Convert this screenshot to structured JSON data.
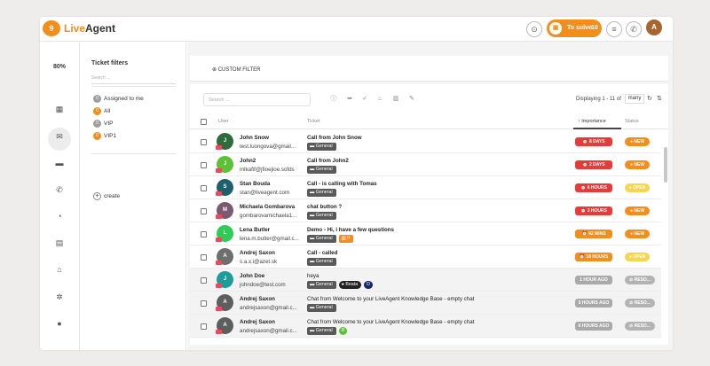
{
  "app": {
    "logo_badge": "9",
    "logo_live": "Live",
    "logo_agent": "Agent",
    "brand_color": "#f28e1c"
  },
  "topbar": {
    "to_solve_label": "To solve",
    "to_solve_count": "10",
    "user_initial": "A",
    "icons": [
      "settings-icon",
      "chat-icon",
      "phone-icon"
    ]
  },
  "nav": {
    "zoom": "80%",
    "items": [
      "dashboard-icon",
      "tickets-icon",
      "chats-icon",
      "calls-icon",
      "reports-icon",
      "contacts-icon",
      "knowledgebase-icon",
      "configuration-icon",
      "help-icon"
    ]
  },
  "filters": {
    "title": "Ticket filters",
    "search_placeholder": "Search ...",
    "items": [
      {
        "label": "Assigned to me",
        "badge": "0",
        "color": "#9e9e9e"
      },
      {
        "label": "All",
        "badge": "0",
        "color": "#f28e1c"
      },
      {
        "label": "VIP",
        "badge": "0",
        "color": "#9e9e9e"
      },
      {
        "label": "VIP1",
        "badge": "0",
        "color": "#f28e1c"
      }
    ],
    "create_label": "create"
  },
  "main": {
    "custom_filter": "CUSTOM FILTER",
    "search_placeholder": "Search ...",
    "displaying": "Displaying 1 - 11 of",
    "many": "many",
    "columns": {
      "user": "User",
      "ticket": "Ticket",
      "importance": "Importance",
      "status": "Status"
    }
  },
  "rows": [
    {
      "name": "John Snow",
      "email": "test.luongova@gmail...",
      "subject": "Call from John Snow",
      "tags": [
        "General"
      ],
      "importance": "8 DAYS",
      "status": "NEW",
      "initial": "J",
      "avatar_color": "#2f6b3c",
      "imp_color": "red",
      "status_type": "new"
    },
    {
      "name": "John2",
      "email": "mlkafif@jfioejioe.sofds",
      "subject": "Call from John2",
      "tags": [
        "General"
      ],
      "importance": "2 DAYS",
      "status": "NEW",
      "initial": "J",
      "avatar_color": "#5bc236",
      "imp_color": "red",
      "status_type": "new"
    },
    {
      "name": "Stan Bouda",
      "email": "stan@liveagent.com",
      "subject": "Call - is calling with Tomas",
      "tags": [
        "General"
      ],
      "importance": "6 HOURS",
      "status": "OPEN",
      "initial": "S",
      "avatar_color": "#1e5f6b",
      "imp_color": "red",
      "status_type": "open"
    },
    {
      "name": "Michaela Gombarova",
      "email": "gombarovamichaela1...",
      "subject": "chat button ?",
      "tags": [
        "General"
      ],
      "importance": "3 HOURS",
      "status": "NEW",
      "initial": "M",
      "avatar_color": "#7a5a6e",
      "imp_color": "red",
      "status_type": "new"
    },
    {
      "name": "Lena Butler",
      "email": "lena.m.butler@gmail.c...",
      "subject": "Demo - Hi, i have a few questions",
      "tags": [
        "General",
        "II"
      ],
      "importance": "42 MINS",
      "status": "NEW",
      "initial": "L",
      "avatar_color": "#2ecc55",
      "imp_color": "orange",
      "status_type": "new"
    },
    {
      "name": "Andrej Saxon",
      "email": "s.a.x.i@azet.sk",
      "subject": "Call - called",
      "tags": [
        "General"
      ],
      "importance": "18 HOURS",
      "status": "OPEN",
      "initial": "A",
      "avatar_color": "#6e6e6e",
      "imp_color": "orange",
      "status_type": "open"
    },
    {
      "name": "John Doe",
      "email": "johndoe@test.com",
      "subject": "heya",
      "tags": [
        "General",
        "Beata",
        "D"
      ],
      "importance": "1 HOUR AGO",
      "status": "RESO...",
      "initial": "J",
      "avatar_color": "#1f9c99",
      "imp_color": "grey",
      "status_type": "reso"
    },
    {
      "name": "Andrej Saxon",
      "email": "andrejsaxon@gmail.c...",
      "subject": "Chat from Welcome to your LiveAgent Knowledge Base - empty chat",
      "tags": [
        "General"
      ],
      "importance": "5 HOURS AGO",
      "status": "RESO...",
      "initial": "A",
      "avatar_color": "#5e5e5e",
      "imp_color": "grey",
      "status_type": "reso"
    },
    {
      "name": "Andrej Saxon",
      "email": "andrejsaxon@gmail.c...",
      "subject": "Chat from Welcome to your LiveAgent Knowledge Base - empty chat",
      "tags": [
        "General",
        "R"
      ],
      "importance": "6 HOURS AGO",
      "status": "RESO...",
      "initial": "A",
      "avatar_color": "#5e5e5e",
      "imp_color": "grey",
      "status_type": "reso"
    }
  ]
}
